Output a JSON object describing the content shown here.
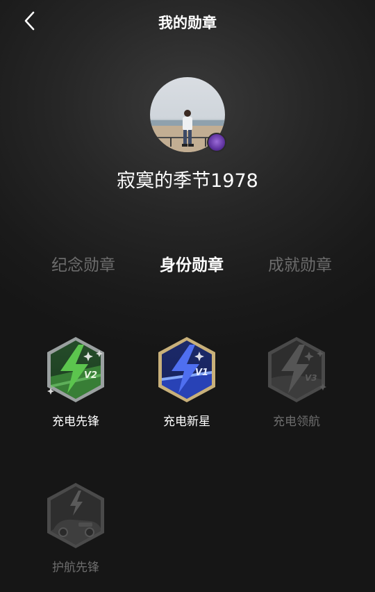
{
  "header": {
    "title": "我的勋章",
    "back_icon": "chevron-left-icon"
  },
  "profile": {
    "username": "寂寞的季节1978",
    "avatar_badge_color": "#7a48c0"
  },
  "tabs": [
    {
      "label": "纪念勋章",
      "active": false
    },
    {
      "label": "身份勋章",
      "active": true
    },
    {
      "label": "成就勋章",
      "active": false
    }
  ],
  "badges": [
    {
      "label": "充电先锋",
      "level": "V2",
      "locked": false,
      "color": "#3f8f3a"
    },
    {
      "label": "充电新星",
      "level": "V1",
      "locked": false,
      "color": "#2d46b6"
    },
    {
      "label": "充电领航",
      "level": "V3",
      "locked": true,
      "color": "#4a4a4a"
    },
    {
      "label": "护航先锋",
      "level": "",
      "locked": true,
      "color": "#4a4a4a"
    }
  ]
}
